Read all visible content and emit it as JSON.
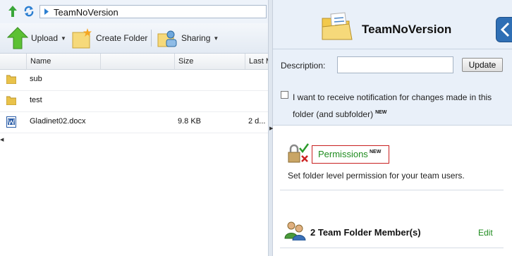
{
  "address": {
    "path": "TeamNoVersion"
  },
  "toolbar": {
    "upload_label": "Upload",
    "create_folder_label": "Create Folder",
    "sharing_label": "Sharing"
  },
  "grid": {
    "columns": {
      "name": "Name",
      "size": "Size",
      "modified": "Last M"
    },
    "rows": [
      {
        "icon": "folder-icon",
        "name": "sub",
        "size": "",
        "modified": ""
      },
      {
        "icon": "folder-icon",
        "name": "test",
        "size": "",
        "modified": ""
      },
      {
        "icon": "word-doc-icon",
        "name": "Gladinet02.docx",
        "size": "9.8 KB",
        "modified": "2 d..."
      }
    ]
  },
  "properties": {
    "folder_name": "TeamNoVersion",
    "description_label": "Description:",
    "description_value": "",
    "update_label": "Update",
    "notification_text": "I want to receive notification for changes made in this folder (and subfolder)",
    "new_badge": "NEW",
    "permissions_link": "Permissions",
    "permissions_desc": "Set folder level permission for your team users.",
    "members_label": "2 Team Folder Member(s)",
    "edit_label": "Edit"
  },
  "colors": {
    "accent_green": "#1f8c1f",
    "highlight_red": "#c82020",
    "panel_bg": "#e9f0f9"
  }
}
